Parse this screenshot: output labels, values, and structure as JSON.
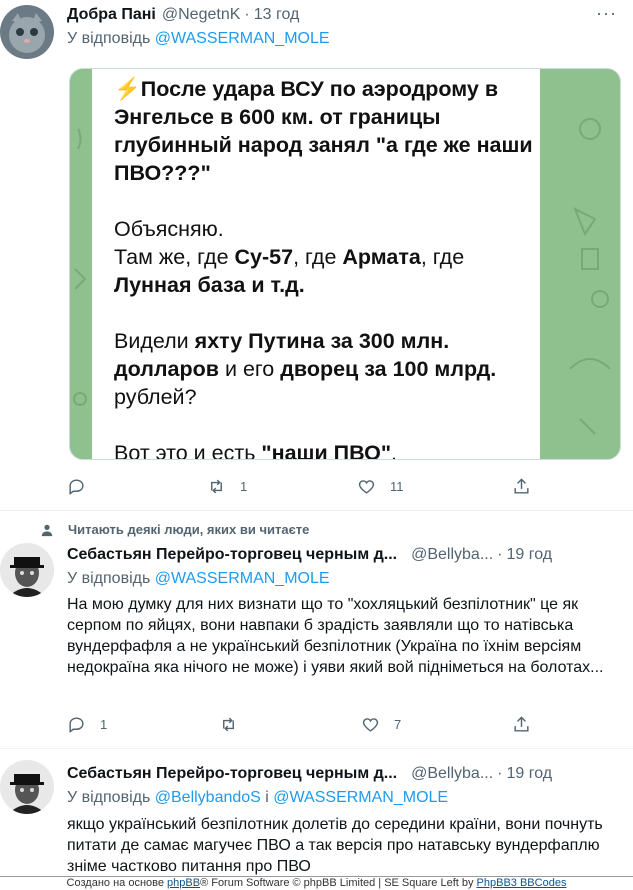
{
  "tweet1": {
    "name": "Добра Пані",
    "handle": "@NegetnK",
    "time": "13 год",
    "reply_prefix": "У відповідь",
    "reply_to": "@WASSERMAN_MOLE",
    "media": {
      "emoji": "⚡",
      "p1": "После удара ВСУ по аэродрому в Энгельсе в 600 км. от границы глубинный народ занял \"а где же наши ПВО???\"",
      "p2_a": "Объясняю.",
      "p2_b": "Там же, где ",
      "p2_c": "Су-57",
      "p2_d": ", где ",
      "p2_e": "Армата",
      "p2_f": ", где",
      "p2_g": "Лунная база и т.д.",
      "p3_a": "Видели ",
      "p3_b": "яхту Путина за 300 млн. долларов",
      "p3_c": " и его ",
      "p3_d": "дворец за 100 млрд.",
      "p3_e": " рублей?",
      "p4_a": "Вот это и есть ",
      "p4_b": "\"наши ПВО\"",
      "p4_c": "."
    },
    "replies": "",
    "retweets": "1",
    "likes": "11"
  },
  "social_context": "Читають деякі люди, яких ви читаєте",
  "tweet2": {
    "name": "Себастьян Перейро-торговец черным д...",
    "handle": "@Bellyba...",
    "time": "19 год",
    "reply_prefix": "У відповідь",
    "reply_to": "@WASSERMAN_MOLE",
    "text": "На мою думку для них визнати що то  \"хохляцький безпілотник\" це як серпом по яйцях, вони навпаки б зрадість заявляли що то натівська вундерфафля а не український безпілотник (Україна по їхнім версіям недокраїна яка нічого не може) і уяви який вой підніметься на болотах...",
    "replies": "1",
    "retweets": "",
    "likes": "7"
  },
  "tweet3": {
    "name": "Себастьян Перейро-торговец черным д...",
    "handle": "@Bellyba...",
    "time": "19 год",
    "reply_prefix": "У відповідь",
    "reply_to_1": "@BellybandoS",
    "reply_and": " і ",
    "reply_to_2": "@WASSERMAN_MOLE",
    "text": "якщо український безпілотник долетів до середини країни, вони почнуть питати де самає магучеє ПВО а так версія про натавську вундерфаплю зніме частково питання про ПВО"
  },
  "footer": {
    "prefix": "Создано на основе ",
    "phpbb": "phpBB",
    "mid": "® Forum Software © phpBB Limited | SE Square Left by ",
    "phpbb3": "PhpBB3 BBCodes"
  }
}
